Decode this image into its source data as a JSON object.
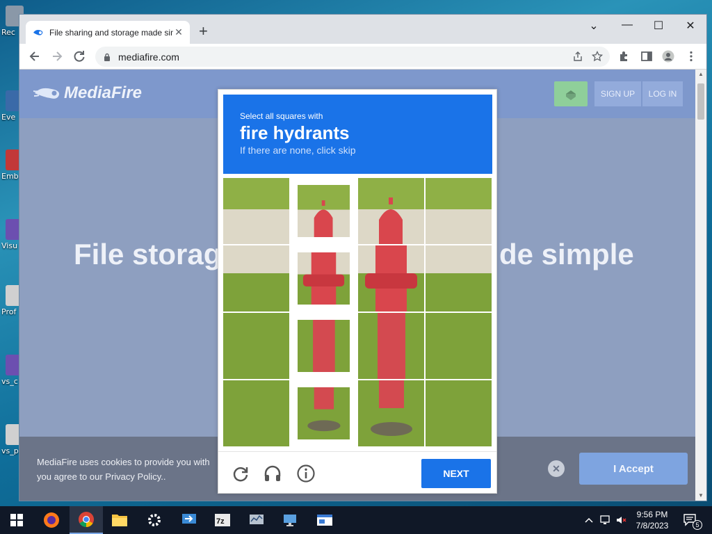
{
  "desktop": {
    "icons": [
      {
        "label": "Rec",
        "color": "#8a98a8"
      },
      {
        "label": "Eve",
        "color": "#3a6aa8"
      },
      {
        "label": "Emb De",
        "color": "#c23838"
      },
      {
        "label": "Visu",
        "color": "#6c4fb0"
      },
      {
        "label": "Prof",
        "color": "#d0d0d0"
      },
      {
        "label": "vs_c",
        "color": "#6c4fb0"
      },
      {
        "label": "vs_p",
        "color": "#d0d0d0"
      }
    ]
  },
  "browser": {
    "tab_title": "File sharing and storage made simple",
    "tab_close": "✕",
    "new_tab": "+",
    "url": "mediafire.com",
    "window_controls": {
      "chevron": "⌄",
      "minimize": "—",
      "maximize": "☐",
      "close": "✕"
    }
  },
  "mediafire": {
    "brand": "MediaFire",
    "signup": "SIGN UP",
    "login": "LOG IN",
    "hero_left": "File storag",
    "hero_right": "de simple",
    "cookie_text": "MediaFire uses cookies to provide you with you agree to our Privacy Policy..",
    "cookie_accept": "I Accept",
    "cookie_close": "✕",
    "colors": {
      "header": "#7e98cc",
      "overlay": "#8e9fc0"
    }
  },
  "captcha": {
    "instruction": "Select all squares with",
    "target": "fire hydrants",
    "hint": "If there are none, click skip",
    "next": "NEXT",
    "accent": "#1a73e8",
    "grid": [
      [
        false,
        true,
        false,
        false
      ],
      [
        false,
        true,
        false,
        false
      ],
      [
        false,
        true,
        false,
        false
      ],
      [
        false,
        true,
        false,
        false
      ]
    ],
    "footer_icons": [
      "reload-icon",
      "audio-icon",
      "info-icon"
    ]
  },
  "taskbar": {
    "apps": [
      "start-icon",
      "search-icon",
      "firefox-icon",
      "chrome-icon",
      "file-explorer-icon",
      "settings-icon",
      "remote-desktop-icon",
      "7zip-icon",
      "network-monitor-icon",
      "computer-icon",
      "app-window-icon"
    ],
    "time": "9:56 PM",
    "date": "7/8/2023",
    "notification_count": "5"
  }
}
